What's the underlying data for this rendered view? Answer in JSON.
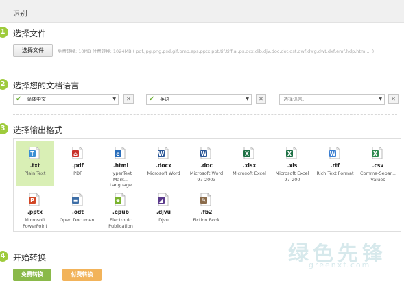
{
  "header": {
    "title": "识别"
  },
  "steps": [
    {
      "num": "1",
      "title": "选择文件"
    },
    {
      "num": "2",
      "title": "选择您的文档语言"
    },
    {
      "num": "3",
      "title": "选择输出格式"
    },
    {
      "num": "4",
      "title": "开始转换"
    }
  ],
  "file": {
    "choose_label": "选择文件",
    "note": "免费转换: 10MB  付费转换: 1024MB  ( pdf,jpg,png,psd,gif,bmp,eps,pptx,ppt,tif,tiff,ai,ps,dcx,dib,djv,doc,dot,dst,dwf,dwg,dwt,dxf,emf,hdp,htm,... )"
  },
  "languages": [
    {
      "value": "简体中文",
      "placeholder": false
    },
    {
      "value": "英语",
      "placeholder": false
    },
    {
      "value": "选择语言..",
      "placeholder": true
    }
  ],
  "clear_symbol": "✕",
  "select_arrow": "▼",
  "check_symbol": "✔",
  "formats": [
    {
      "ext": ".txt",
      "desc": "Plain Text",
      "icon": "txt-file-icon",
      "color": "#3b8fd4",
      "letter": "T",
      "selected": true
    },
    {
      "ext": ".pdf",
      "desc": "PDF",
      "icon": "pdf-file-icon",
      "color": "#c9322b",
      "letter": "⌂",
      "selected": false
    },
    {
      "ext": ".html",
      "desc": "HyperText Mark... Language",
      "icon": "html-file-icon",
      "color": "#2a6ebb",
      "letter": "e",
      "selected": false
    },
    {
      "ext": ".docx",
      "desc": "Microsoft Word",
      "icon": "word-file-icon",
      "color": "#2b5797",
      "letter": "W",
      "selected": false
    },
    {
      "ext": ".doc",
      "desc": "Microsoft Word 97-2003",
      "icon": "word-file-icon",
      "color": "#2b5797",
      "letter": "W",
      "selected": false
    },
    {
      "ext": ".xlsx",
      "desc": "Microsoft Excel",
      "icon": "excel-file-icon",
      "color": "#1e7145",
      "letter": "X",
      "selected": false
    },
    {
      "ext": ".xls",
      "desc": "Microsoft Excel 97-200",
      "icon": "excel-file-icon",
      "color": "#1e7145",
      "letter": "X",
      "selected": false
    },
    {
      "ext": ".rtf",
      "desc": "Rich Text Format",
      "icon": "rtf-file-icon",
      "color": "#3b7fd1",
      "letter": "W",
      "selected": false
    },
    {
      "ext": ".csv",
      "desc": "Comma-Separ... Values",
      "icon": "csv-file-icon",
      "color": "#2d8a4e",
      "letter": "X",
      "selected": false
    },
    {
      "ext": ".pptx",
      "desc": "Microsoft PowerPoint",
      "icon": "powerpoint-file-icon",
      "color": "#d24726",
      "letter": "P",
      "selected": false
    },
    {
      "ext": ".odt",
      "desc": "Open Document",
      "icon": "odt-file-icon",
      "color": "#3d6ea6",
      "letter": "≡",
      "selected": false
    },
    {
      "ext": ".epub",
      "desc": "Electronic Publication",
      "icon": "epub-file-icon",
      "color": "#7ab32e",
      "letter": "e",
      "selected": false
    },
    {
      "ext": ".djvu",
      "desc": "Djvu",
      "icon": "djvu-file-icon",
      "color": "#5b3a8c",
      "letter": "◢",
      "selected": false
    },
    {
      "ext": ".fb2",
      "desc": "Fiction Book",
      "icon": "fb2-file-icon",
      "color": "#8a6b4a",
      "letter": "✎",
      "selected": false
    }
  ],
  "actions": {
    "free_label": "免费转换",
    "paid_label": "付费转换"
  },
  "watermark": {
    "main": "绿色先锋",
    "sub": "greenxf.com"
  }
}
